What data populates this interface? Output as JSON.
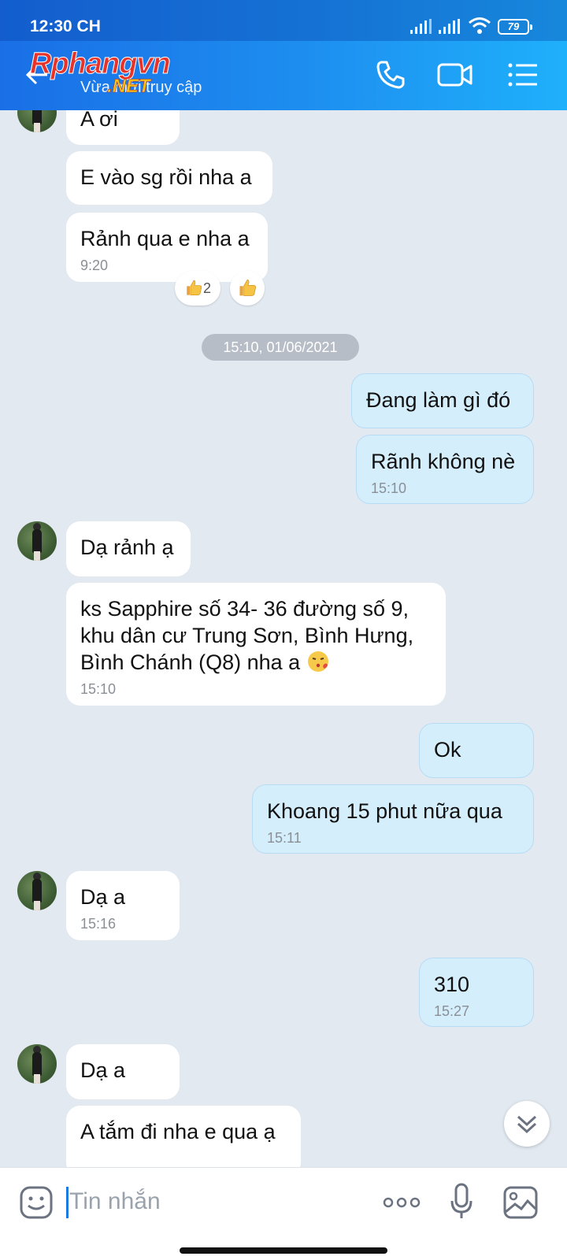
{
  "status_bar": {
    "time": "12:30 CH",
    "battery": "79"
  },
  "header": {
    "subtitle": "Vừa mới truy cập",
    "watermark_brand": "Rphangvn",
    "watermark_suffix": ".NET"
  },
  "messages": [
    {
      "id": "m1",
      "side": "received",
      "text": "A ơi",
      "time": ""
    },
    {
      "id": "m2",
      "side": "received",
      "text": "E vào sg rồi nha a",
      "time": ""
    },
    {
      "id": "m3",
      "side": "received",
      "text": "Rảnh qua e nha a",
      "time": "9:20"
    },
    {
      "id": "m4",
      "side": "sent",
      "text": "Đang làm gì đó",
      "time": ""
    },
    {
      "id": "m5",
      "side": "sent",
      "text": "Rãnh không nè",
      "time": "15:10"
    },
    {
      "id": "m6",
      "side": "received",
      "text": "Dạ rảnh ạ",
      "time": ""
    },
    {
      "id": "m7",
      "side": "received",
      "lines": [
        "ks Sapphire số 34- 36 đường số 9,",
        "khu dân cư Trung Sơn,  Bình Hưng,",
        "Bình Chánh (Q8) nha a"
      ],
      "time": "15:10"
    },
    {
      "id": "m8",
      "side": "sent",
      "text": "Ok",
      "time": ""
    },
    {
      "id": "m9",
      "side": "sent",
      "text": "Khoang 15 phut nữa qua",
      "time": "15:11"
    },
    {
      "id": "m10",
      "side": "received",
      "text": "Dạ a",
      "time": "15:16"
    },
    {
      "id": "m11",
      "side": "sent",
      "text": "310",
      "time": "15:27"
    },
    {
      "id": "m12",
      "side": "received",
      "text": "Dạ a",
      "time": ""
    },
    {
      "id": "m13",
      "side": "received",
      "text": "A tắm đi nha e qua ạ",
      "time": ""
    }
  ],
  "reactions": {
    "count": "2"
  },
  "date_separator": "15:10, 01/06/2021",
  "input": {
    "placeholder": "Tin nhắn"
  },
  "colors": {
    "header_start": "#1a6fe6",
    "header_end": "#1fb0fb",
    "sent_bubble": "#d5eefc",
    "received_bubble": "#ffffff",
    "chat_background": "#e2e9f1"
  }
}
